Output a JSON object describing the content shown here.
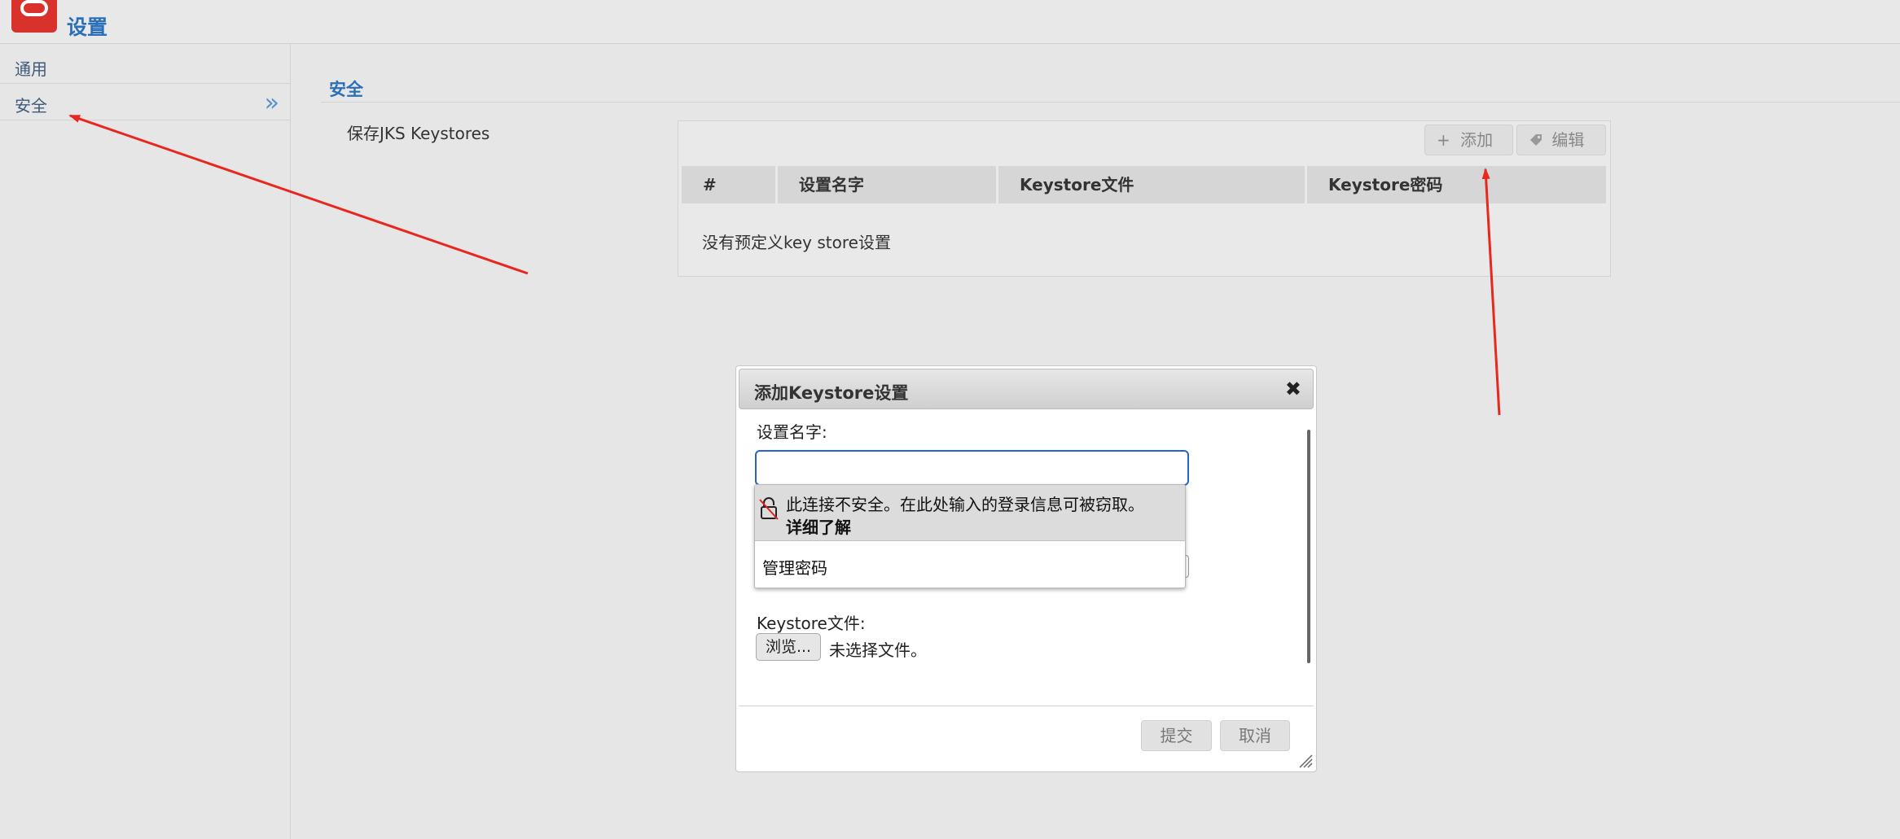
{
  "app": {
    "title": "设置"
  },
  "sidebar": {
    "items": [
      {
        "label": "通用"
      },
      {
        "label": "安全",
        "chevron": "»"
      }
    ]
  },
  "main": {
    "section_title": "安全",
    "keystores_label": "保存JKS Keystores",
    "toolbar": {
      "add_label": "添加",
      "edit_label": "编辑"
    },
    "table": {
      "columns": [
        "#",
        "设置名字",
        "Keystore文件",
        "Keystore密码"
      ],
      "empty_message": "没有预定义key store设置"
    }
  },
  "dialog": {
    "title": "添加Keystore设置",
    "close_glyph": "✖",
    "name_label": "设置名字:",
    "name_value": "",
    "file_label": "Keystore文件:",
    "browse_label": "浏览...",
    "no_file_text": "未选择文件。",
    "submit_label": "提交",
    "cancel_label": "取消"
  },
  "autofill_popup": {
    "warning": "此连接不安全。在此处输入的登录信息可被窃取。",
    "learn_more": "详细了解",
    "manage_passwords": "管理密码"
  },
  "colors": {
    "accent": "#2a6fb8",
    "logo": "#d9322d",
    "annotation_arrow": "#e8281e",
    "focus_border": "#2b62c8"
  }
}
